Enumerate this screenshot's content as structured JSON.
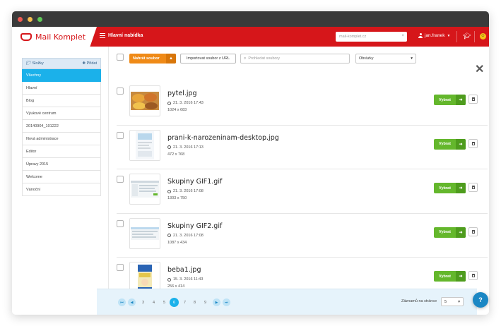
{
  "header": {
    "logo_text": "Mail Komplet",
    "menu_label": "Hlavní nabídka",
    "search_value": "mail-komplet.cz",
    "user_name": "jan.franek"
  },
  "sidebar": {
    "folders_label": "Složky",
    "add_label": "Přidat",
    "items": [
      {
        "label": "Všechny"
      },
      {
        "label": "Hlavní"
      },
      {
        "label": "Blog"
      },
      {
        "label": "Výukové centrum"
      },
      {
        "label": "20140904_101222"
      },
      {
        "label": "Nová administrace"
      },
      {
        "label": "Editor"
      },
      {
        "label": "Úpravy 2015"
      },
      {
        "label": "Welcome"
      },
      {
        "label": "Vánoční"
      }
    ]
  },
  "toolbar": {
    "upload_label": "Nahrát soubor",
    "import_label": "Importovat soubor z URL",
    "search_placeholder": "Prohledat soubory",
    "type_select_value": "Obrázky"
  },
  "files": [
    {
      "name": "pytel.jpg",
      "date": "21. 3. 2016 17:43",
      "size": "1024 x 683",
      "thumb": "bowls"
    },
    {
      "name": "prani-k-narozeninam-desktop.jpg",
      "date": "21. 3. 2016 17:13",
      "size": "472 x 768",
      "thumb": "document"
    },
    {
      "name": "Skupiny GIF1.gif",
      "date": "21. 3. 2016 17:08",
      "size": "1303 x 750",
      "thumb": "screenshot"
    },
    {
      "name": "Skupiny GIF2.gif",
      "date": "21. 3. 2016 17:08",
      "size": "1087 x 434",
      "thumb": "screenshot2"
    },
    {
      "name": "beba1.jpg",
      "date": "15. 3. 2016 11:43",
      "size": "256 x 414",
      "thumb": "beba"
    }
  ],
  "row_actions": {
    "select_label": "Vybrat"
  },
  "pagination": {
    "pages": [
      "3",
      "4",
      "5",
      "6",
      "7",
      "8",
      "9"
    ],
    "current": "6",
    "per_page_label": "Záznamů na stránce",
    "per_page_value": "5"
  },
  "help_label": "?"
}
